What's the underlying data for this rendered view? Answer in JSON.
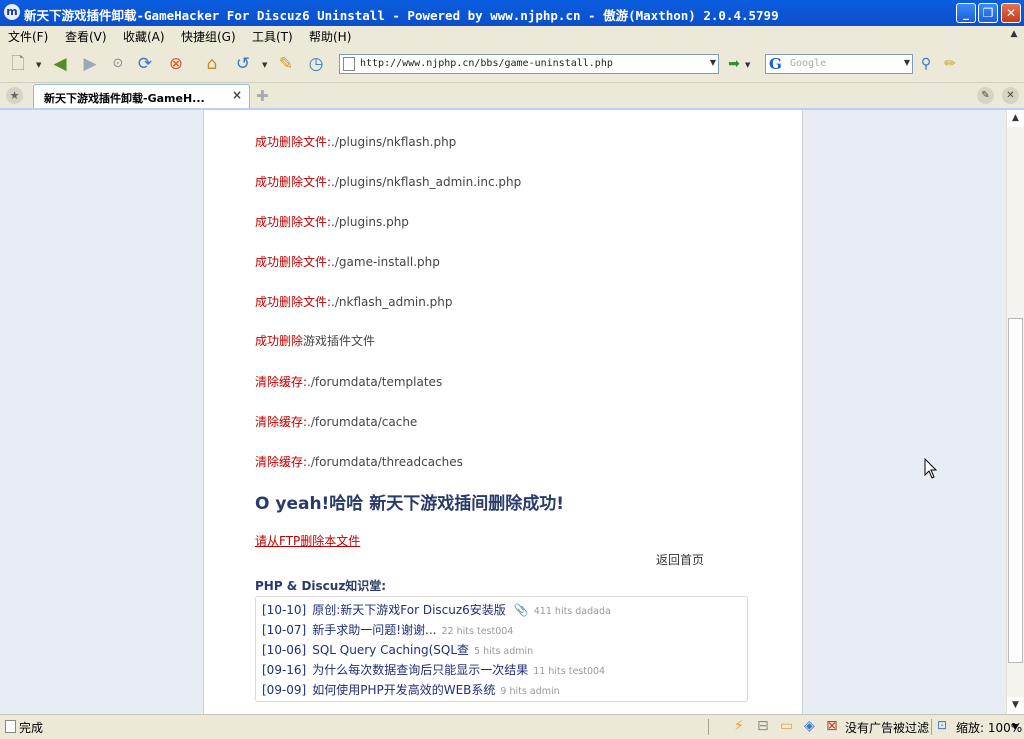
{
  "window": {
    "title": "新天下游戏插件卸载-GameHacker For Discuz6 Uninstall - Powered by www.njphp.cn - 傲游(Maxthon) 2.0.4.5799",
    "app_icon": "m"
  },
  "menu": [
    "文件(F)",
    "查看(V)",
    "收藏(A)",
    "快捷组(G)",
    "工具(T)",
    "帮助(H)"
  ],
  "address": {
    "url": "http://www.njphp.cn/bbs/game-uninstall.php"
  },
  "search": {
    "placeholder": "Google",
    "engine_letter": "G"
  },
  "tab": {
    "label": "新天下游戏插件卸载-GameH...",
    "close": "×"
  },
  "content": {
    "lines": [
      {
        "prefix": "成功删除文件:",
        "text": "./plugins/nkflash.php"
      },
      {
        "prefix": "成功删除文件:",
        "text": "./plugins/nkflash_admin.inc.php"
      },
      {
        "prefix": "成功删除文件:",
        "text": "./plugins.php"
      },
      {
        "prefix": "成功删除文件:",
        "text": "./game-install.php"
      },
      {
        "prefix": "成功删除文件:",
        "text": "./nkflash_admin.php"
      },
      {
        "prefix": "成功删除",
        "text": "游戏插件文件"
      },
      {
        "prefix": "清除缓存:",
        "text": "./forumdata/templates"
      },
      {
        "prefix": "清除缓存:",
        "text": "./forumdata/cache"
      },
      {
        "prefix": "清除缓存:",
        "text": "./forumdata/threadcaches"
      }
    ],
    "success_heading": "O yeah!哈哈  新天下游戏插间删除成功!",
    "ftp_link": "请从FTP删除本文件",
    "home_link": "返回首页",
    "kb_title": "PHP & Discuz知识堂:",
    "kb_items": [
      {
        "date": "[10-10]",
        "title": "原创:新天下游戏For Discuz6安装版",
        "meta": "411 hits dadada",
        "attachment": true
      },
      {
        "date": "[10-07]",
        "title": "新手求助一问题!谢谢...",
        "meta": "22 hits test004",
        "attachment": false
      },
      {
        "date": "[10-06]",
        "title": "SQL Query Caching(SQL查",
        "meta": "5 hits admin",
        "attachment": false
      },
      {
        "date": "[09-16]",
        "title": "为什么每次数据查询后只能显示一次结果",
        "meta": "11 hits test004",
        "attachment": false
      },
      {
        "date": "[09-09]",
        "title": "如何使用PHP开发高效的WEB系统",
        "meta": "9 hits admin",
        "attachment": false
      }
    ]
  },
  "statusbar": {
    "status": "完成",
    "adblock": "没有广告被过滤",
    "zoom": "缩放: 100%"
  },
  "colors": {
    "title_bar": "#0b57d6",
    "red_prefix": "#c00000",
    "link_blue": "#1f2f78",
    "page_bg": "#e8ecf4"
  }
}
